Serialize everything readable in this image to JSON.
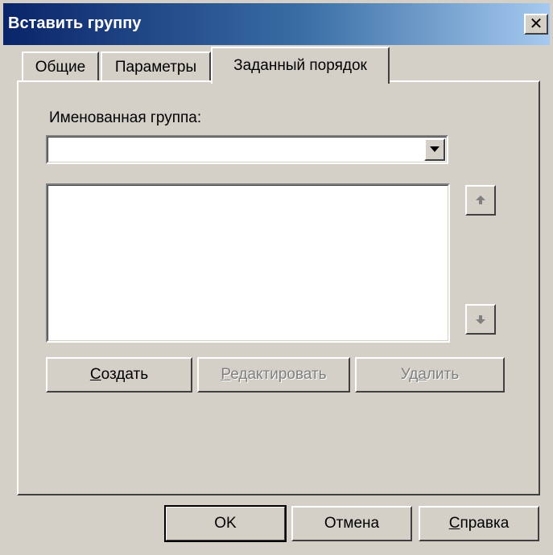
{
  "dialog": {
    "title": "Вставить группу",
    "close_symbol": "✕"
  },
  "tabs": [
    {
      "label": "Общие",
      "active": false
    },
    {
      "label": "Параметры",
      "active": false
    },
    {
      "label": "Заданный порядок",
      "active": true
    }
  ],
  "panel": {
    "named_group_label": "Именованная группа:",
    "named_group_value": "",
    "list_items": [],
    "move_up_icon": "arrow-up-icon",
    "move_down_icon": "arrow-down-icon",
    "create_button": {
      "pre": "",
      "mn": "С",
      "post": "оздать",
      "enabled": true
    },
    "edit_button": {
      "pre": "",
      "mn": "Р",
      "post": "едактировать",
      "enabled": false
    },
    "delete_button": {
      "pre": "Уд",
      "mn": "а",
      "post": "лить",
      "enabled": false
    }
  },
  "footer": {
    "ok_label": "OK",
    "cancel_label": "Отмена",
    "help_button": {
      "pre": "",
      "mn": "С",
      "post": "правка"
    }
  }
}
